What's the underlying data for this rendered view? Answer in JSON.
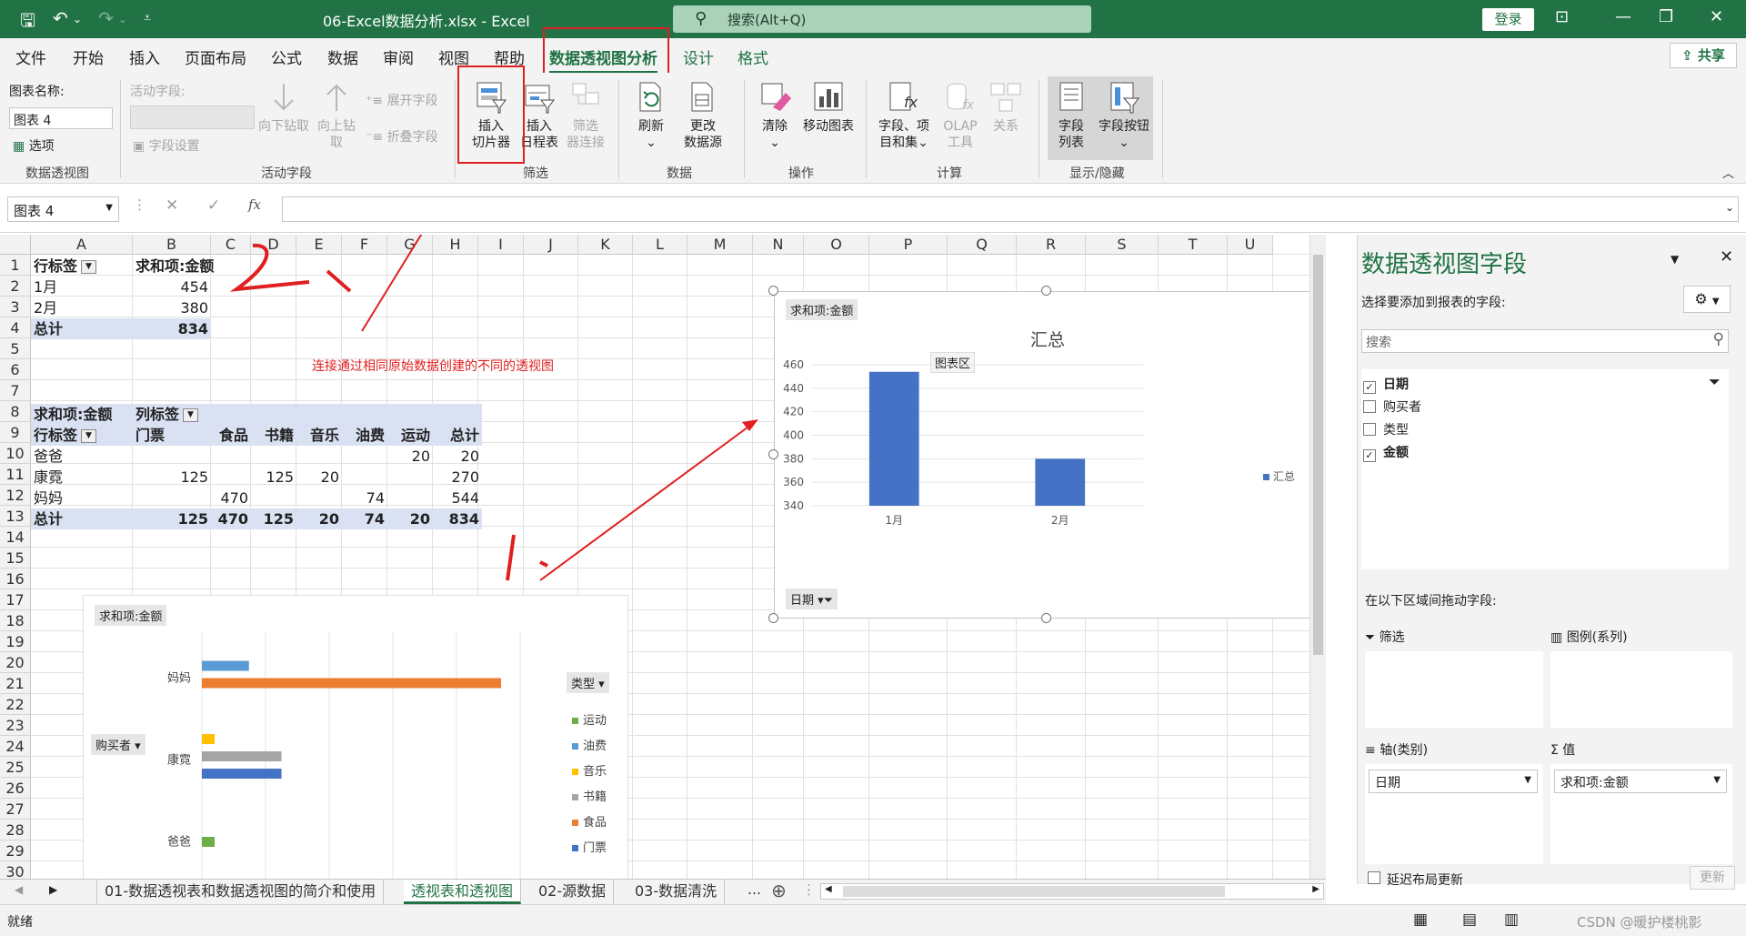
{
  "titlebar": {
    "title": "06-Excel数据分析.xlsx  -  Excel",
    "search_placeholder": "搜索(Alt+Q)",
    "login": "登录"
  },
  "ribbon_tabs": [
    "文件",
    "开始",
    "插入",
    "页面布局",
    "公式",
    "数据",
    "审阅",
    "视图",
    "帮助",
    "数据透视图分析",
    "设计",
    "格式"
  ],
  "share_label": "共享",
  "ribbon": {
    "chartname_label": "图表名称:",
    "chartname_value": "图表 4",
    "options_label": "选项",
    "group_pivotchart": "数据透视图",
    "active_field_label": "活动字段:",
    "field_settings": "字段设置",
    "drill_down": "向下钻取",
    "drill_up_1": "向上钻",
    "drill_up_2": "取",
    "expand_field": "展开字段",
    "collapse_field": "折叠字段",
    "group_active_field": "活动字段",
    "insert_slicer_1": "插入",
    "insert_slicer_2": "切片器",
    "insert_timeline_1": "插入",
    "insert_timeline_2": "日程表",
    "filter_conn_1": "筛选",
    "filter_conn_2": "器连接",
    "group_filter": "筛选",
    "refresh": "刷新",
    "change_source_1": "更改",
    "change_source_2": "数据源",
    "group_data": "数据",
    "clear": "清除",
    "move_chart": "移动图表",
    "group_actions": "操作",
    "fields_items_1": "字段、项",
    "fields_items_2": "目和集",
    "olap_1": "OLAP",
    "olap_2": "工具",
    "relationships": "关系",
    "group_calc": "计算",
    "field_list_1": "字段",
    "field_list_2": "列表",
    "field_buttons": "字段按钮",
    "group_showhide": "显示/隐藏"
  },
  "formula_bar": {
    "namebox": "图表 4",
    "fx": "fx"
  },
  "columns": [
    "A",
    "B",
    "C",
    "D",
    "E",
    "F",
    "G",
    "H",
    "I",
    "J",
    "K",
    "L",
    "M",
    "N",
    "O",
    "P",
    "Q",
    "R",
    "S",
    "T",
    "U"
  ],
  "rows": [
    "1",
    "2",
    "3",
    "4",
    "5",
    "6",
    "7",
    "8",
    "9",
    "10",
    "11",
    "12",
    "13",
    "14",
    "15",
    "16",
    "17",
    "18",
    "19",
    "20",
    "21",
    "22",
    "23",
    "24",
    "25",
    "26",
    "27",
    "28",
    "29",
    "30"
  ],
  "pivot1": {
    "header_row_label": "行标签",
    "header_sum": "求和项:金额",
    "rows": [
      {
        "label": "1月",
        "value": "454"
      },
      {
        "label": "2月",
        "value": "380"
      }
    ],
    "total_label": "总计",
    "total_value": "834"
  },
  "note": "连接通过相同原始数据创建的不同的透视图",
  "pivot2": {
    "sum_label": "求和项:金额",
    "col_labels": "列标签",
    "row_labels": "行标签",
    "columns": [
      "门票",
      "食品",
      "书籍",
      "音乐",
      "油费",
      "运动",
      "总计"
    ],
    "rows": [
      {
        "label": "爸爸",
        "values": [
          "",
          "",
          "",
          "",
          "",
          "20",
          "20"
        ]
      },
      {
        "label": "康霓",
        "values": [
          "125",
          "",
          "125",
          "20",
          "",
          "",
          "270"
        ]
      },
      {
        "label": "妈妈",
        "values": [
          "",
          "470",
          "",
          "",
          "74",
          "",
          "544"
        ]
      }
    ],
    "total_label": "总计",
    "total_values": [
      "125",
      "470",
      "125",
      "20",
      "74",
      "20",
      "834"
    ]
  },
  "chart_data": [
    {
      "type": "bar",
      "title": "汇总",
      "field_button": "求和项:金额",
      "plot_area_label": "图表区",
      "axis_field_button": "日期",
      "categories": [
        "1月",
        "2月"
      ],
      "series": [
        {
          "name": "汇总",
          "values": [
            454,
            380
          ]
        }
      ],
      "ylim": [
        340,
        460
      ],
      "yticks": [
        "460",
        "440",
        "420",
        "400",
        "380",
        "360",
        "340"
      ],
      "color": "#4472c4",
      "legend": "right"
    },
    {
      "type": "bar",
      "orientation": "horizontal",
      "field_button": "求和项:金额",
      "axis_field_button": "购买者",
      "legend_field_button": "类型",
      "categories": [
        "妈妈",
        "康霓",
        "爸爸"
      ],
      "series": [
        {
          "name": "运动",
          "color": "#70ad47",
          "values": [
            0,
            0,
            20
          ]
        },
        {
          "name": "油费",
          "color": "#5b9bd5",
          "values": [
            74,
            0,
            0
          ]
        },
        {
          "name": "音乐",
          "color": "#ffc000",
          "values": [
            0,
            20,
            0
          ]
        },
        {
          "name": "书籍",
          "color": "#a5a5a5",
          "values": [
            0,
            125,
            0
          ]
        },
        {
          "name": "食品",
          "color": "#ed7d31",
          "values": [
            470,
            0,
            0
          ]
        },
        {
          "name": "门票",
          "color": "#4472c4",
          "values": [
            0,
            125,
            0
          ]
        }
      ],
      "xlim": [
        0,
        500
      ],
      "legend": "right"
    }
  ],
  "field_pane": {
    "title": "数据透视图字段",
    "subtitle": "选择要添加到报表的字段:",
    "search_placeholder": "搜索",
    "fields": [
      {
        "name": "日期",
        "checked": true
      },
      {
        "name": "购买者",
        "checked": false
      },
      {
        "name": "类型",
        "checked": false
      },
      {
        "name": "金额",
        "checked": true
      }
    ],
    "drag_label": "在以下区域间拖动字段:",
    "area_filter": "筛选",
    "area_legend": "图例(系列)",
    "area_axis": "轴(类别)",
    "area_values": "值",
    "axis_item": "日期",
    "values_item": "求和项:金额",
    "defer_label": "延迟布局更新",
    "update_btn": "更新"
  },
  "sheet_tabs": [
    "01-数据透视表和数据透视图的简介和使用",
    "透视表和透视图",
    "02-源数据",
    "03-数据清洗"
  ],
  "statusbar": {
    "ready": "就绪",
    "watermark": "CSDN @暖护楼桃影"
  },
  "annotations": {
    "step1": "1.",
    "step2": "2."
  }
}
